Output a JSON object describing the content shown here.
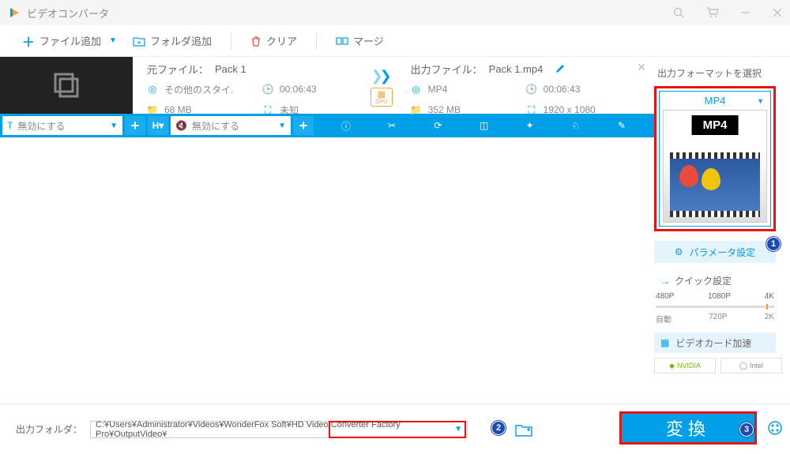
{
  "titlebar": {
    "title": "ビデオコンバータ"
  },
  "toolbar": {
    "add_file": "ファイル追加",
    "add_folder": "フォルダ追加",
    "clear": "クリア",
    "merge": "マージ"
  },
  "file": {
    "source_label": "元ファイル：",
    "source_name": "Pack 1",
    "output_label": "出力ファイル：",
    "output_name": "Pack 1.mp4",
    "src": {
      "format": "その他のスタイ.",
      "duration": "00:06:43",
      "size": "68 MB",
      "resolution": "未知"
    },
    "dst": {
      "format": "MP4",
      "duration": "00:06:43",
      "size": "352 MB",
      "resolution": "1920 x 1080"
    },
    "gpu_label": "GPU"
  },
  "bluebar": {
    "subtitle_disable": "無効にする",
    "audio_disable": "無効にする"
  },
  "right": {
    "title": "出力フォーマットを選択",
    "format_label": "MP4",
    "format_thumb_label": "MP4",
    "param_btn": "パラメータ設定",
    "quick_title": "クイック設定",
    "slider_marks_top": [
      "480P",
      "1080P",
      "4K"
    ],
    "slider_marks_bottom": [
      "自動",
      "720P",
      "2K"
    ],
    "gpu_accel": "ビデオカード加速",
    "brand_nvidia": "NVIDIA",
    "brand_intel": "Intel"
  },
  "bottom": {
    "label": "出力フォルダ：",
    "path": "C:¥Users¥Administrator¥Videos¥WonderFox Soft¥HD Video Converter Factory Pro¥OutputVideo¥",
    "convert": "変換"
  },
  "badges": {
    "b1": "1",
    "b2": "2",
    "b3": "3"
  },
  "chart_data": null
}
